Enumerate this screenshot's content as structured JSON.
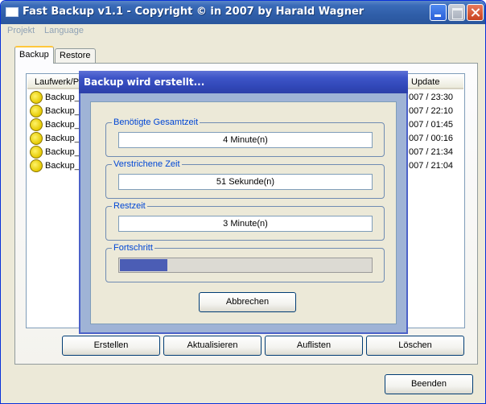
{
  "window": {
    "title": "Fast Backup v1.1 - Copyright © in 2007 by Harald Wagner"
  },
  "menu": {
    "projekt": "Projekt",
    "language": "Language"
  },
  "tabs": [
    {
      "label": "Backup"
    },
    {
      "label": "Restore"
    }
  ],
  "list": {
    "columns": {
      "laufwerk": "Laufwerk/P",
      "update": "Update"
    },
    "rows": [
      {
        "name": "Backup_",
        "date": "007 / 23:30"
      },
      {
        "name": "Backup_",
        "date": "007 / 22:10"
      },
      {
        "name": "Backup_",
        "date": "007 / 01:45"
      },
      {
        "name": "Backup_",
        "date": "007 / 00:16"
      },
      {
        "name": "Backup_",
        "date": "007 / 21:34"
      },
      {
        "name": "Backup_",
        "date": "007 / 21:04"
      }
    ]
  },
  "buttons": {
    "erstellen": "Erstellen",
    "aktualisieren": "Aktualisieren",
    "auflisten": "Auflisten",
    "loeschen": "Löschen",
    "beenden": "Beenden"
  },
  "dialog": {
    "title": "Backup wird erstellt...",
    "total_label": "Benötigte Gesamtzeit",
    "total_value": "4 Minute(n)",
    "elapsed_label": "Verstrichene Zeit",
    "elapsed_value": "51 Sekunde(n)",
    "remaining_label": "Restzeit",
    "remaining_value": "3 Minute(n)",
    "progress_label": "Fortschritt",
    "progress_fraction": 0.19,
    "cancel": "Abbrechen"
  },
  "colors": {
    "progress_fill": "#4b5db5",
    "dialog_title": "#3e55c8",
    "window_title": "#2f5ea8"
  }
}
